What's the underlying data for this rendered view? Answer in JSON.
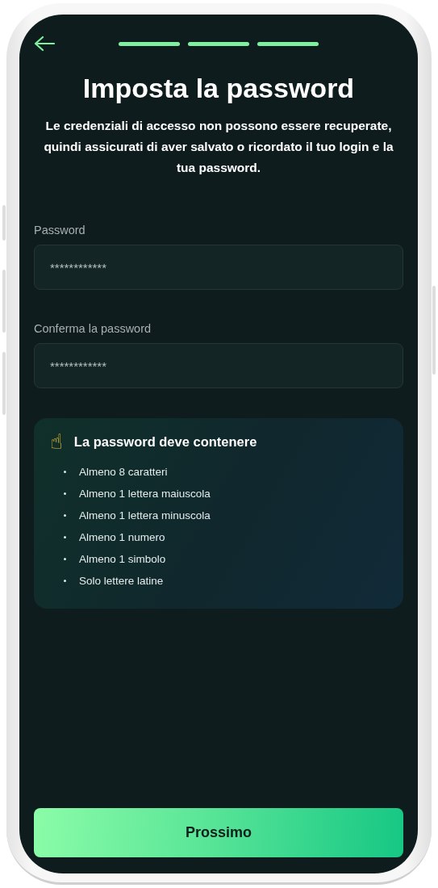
{
  "header": {
    "steps": [
      {
        "done": true
      },
      {
        "done": true
      },
      {
        "done": true
      }
    ]
  },
  "title": "Imposta la password",
  "subtitle": "Le credenziali di accesso non possono essere recuperate, quindi assicurati di aver salvato o ricordato il tuo login e la tua password.",
  "fields": [
    {
      "label": "Password",
      "value": "************"
    },
    {
      "label": "Conferma la password",
      "value": "************"
    }
  ],
  "requirements": {
    "icon": "☝",
    "title": "La password deve contenere",
    "items": [
      "Almeno 8 caratteri",
      "Almeno 1 lettera maiuscola",
      "Almeno 1 lettera minuscola",
      "Almeno 1 numero",
      "Almeno 1 simbolo",
      "Solo lettere latine"
    ]
  },
  "button": "Prossimo"
}
